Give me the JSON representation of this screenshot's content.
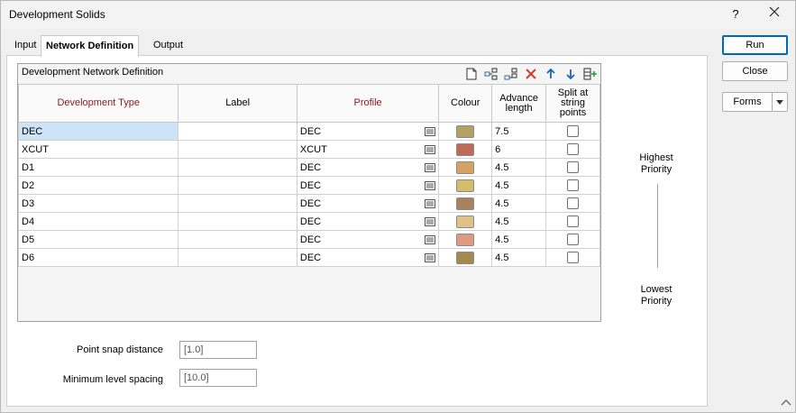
{
  "window": {
    "title": "Development Solids",
    "help_label": "?"
  },
  "tabs": [
    {
      "label": "Input"
    },
    {
      "label": "Network Definition"
    },
    {
      "label": "Output"
    }
  ],
  "grid": {
    "title": "Development Network Definition",
    "toolbar_icons": [
      "new-file-icon",
      "insert-row-icon",
      "append-row-icon",
      "delete-icon",
      "move-up-icon",
      "move-down-icon",
      "add-column-icon"
    ],
    "columns": [
      {
        "label": "Development Type"
      },
      {
        "label": "Label"
      },
      {
        "label": "Profile"
      },
      {
        "label": "Colour"
      },
      {
        "label": "Advance length"
      },
      {
        "label": "Split at string points"
      }
    ],
    "rows": [
      {
        "type": "DEC",
        "label": "",
        "profile": "DEC",
        "colour": "#b1a163",
        "advance": "7.5",
        "split": false
      },
      {
        "type": "XCUT",
        "label": "",
        "profile": "XCUT",
        "colour": "#bf6a56",
        "advance": "6",
        "split": false
      },
      {
        "type": "D1",
        "label": "",
        "profile": "DEC",
        "colour": "#d6a164",
        "advance": "4.5",
        "split": false
      },
      {
        "type": "D2",
        "label": "",
        "profile": "DEC",
        "colour": "#d4bd68",
        "advance": "4.5",
        "split": false
      },
      {
        "type": "D3",
        "label": "",
        "profile": "DEC",
        "colour": "#a7825d",
        "advance": "4.5",
        "split": false
      },
      {
        "type": "D4",
        "label": "",
        "profile": "DEC",
        "colour": "#e0c287",
        "advance": "4.5",
        "split": false
      },
      {
        "type": "D5",
        "label": "",
        "profile": "DEC",
        "colour": "#dc9a82",
        "advance": "4.5",
        "split": false
      },
      {
        "type": "D6",
        "label": "",
        "profile": "DEC",
        "colour": "#a6884f",
        "advance": "4.5",
        "split": false
      }
    ]
  },
  "priority": {
    "high": "Highest Priority",
    "low": "Lowest Priority"
  },
  "fields": {
    "point_snap": {
      "label": "Point snap distance",
      "value": "[1.0]"
    },
    "min_level": {
      "label": "Minimum level spacing",
      "value": "[10.0]"
    }
  },
  "buttons": {
    "run": "Run",
    "close": "Close",
    "forms": "Forms"
  },
  "colors": {
    "required_header": "#8a1a1a",
    "selection": "#cde4f7",
    "accent": "#0067c0"
  }
}
